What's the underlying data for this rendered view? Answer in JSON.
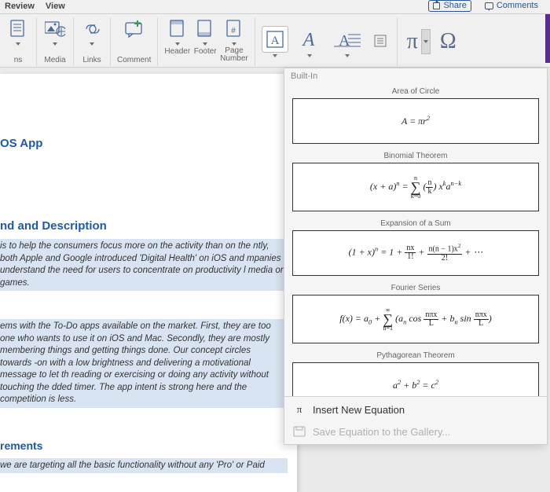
{
  "topbar": {
    "tabs": [
      "Review",
      "View"
    ],
    "share": "Share",
    "comments": "Comments"
  },
  "ribbon": {
    "truncated_label": "ns",
    "media": "Media",
    "links": "Links",
    "comment": "Comment",
    "header": "Header",
    "footer": "Footer",
    "page_number": "Page\nNumber"
  },
  "document": {
    "h1": "OS App",
    "h2": "nd and Description",
    "p1": "is to help the consumers focus more on the activity than on the ntly, both Apple and Google introduced 'Digital Health' on iOS and mpanies understand the need for users to concentrate on productivity l media or games.",
    "p2": "ems with the To-Do apps available on the market. First, they are too one who wants to use it on iOS and Mac. Secondly, they are mostly membering things and getting things done. Our concept circles towards -on with a low brightness and delivering a motivational message to let th reading or exercising or doing any activity without touching the dded timer. The app intent is strong here and the competition is less.",
    "h3": "rements",
    "p3": "we are targeting all the basic functionality without any 'Pro' or Paid"
  },
  "panel": {
    "header": "Built-In",
    "items": [
      {
        "title": "Area of Circle",
        "formula_html": "<span class='math'>A = πr<sup>2</sup></span>"
      },
      {
        "title": "Binomial Theorem",
        "formula_html": "<span class='math'>(x + a)<sup>n</sup> = <span class='sigma'><span class='top'>n</span><span class='sig'>∑</span><span class='bot'>k=0</span></span> (<span class='frac'><span class='num'>n</span><span class='den'>k</span></span>) x<sup>k</sup>a<sup>n−k</sup></span>"
      },
      {
        "title": "Expansion of a Sum",
        "formula_html": "<span class='math'>(1 + x)<sup>n</sup> = 1 + <span class='frac'><span class='num'>nx</span><span class='den'>1!</span></span> + <span class='frac'><span class='num'>n(n − 1)x<sup>2</sup></span><span class='den'>2!</span></span> + ⋯</span>"
      },
      {
        "title": "Fourier Series",
        "formula_html": "<span class='math'>f(x) = a<sub>0</sub> + <span class='sigma'><span class='top'>∞</span><span class='sig'>∑</span><span class='bot'>n=1</span></span> (a<sub>n</sub> cos <span class='frac'><span class='num'>nπx</span><span class='den'>L</span></span> + b<sub>n</sub> sin <span class='frac'><span class='num'>nπx</span><span class='den'>L</span></span>)</span>"
      },
      {
        "title": "Pythagorean Theorem",
        "formula_html": "<span class='math'>a<sup>2</sup> + b<sup>2</sup> = c<sup>2</sup></span>"
      }
    ],
    "insert": "Insert New Equation",
    "save": "Save Equation to the Gallery..."
  }
}
